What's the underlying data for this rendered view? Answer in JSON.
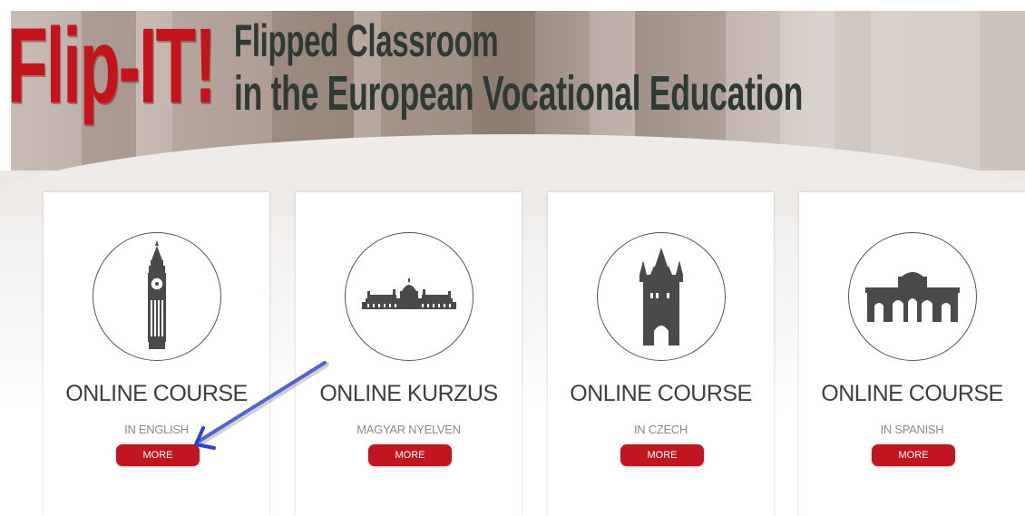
{
  "logo": {
    "brand": "Flip-IT!",
    "tagline_line1": "Flipped Classroom",
    "tagline_line2": "in the European Vocational Education",
    "brand_color": "#c3141d"
  },
  "cards": [
    {
      "icon": "big-ben-icon",
      "title": "ONLINE COURSE",
      "subtitle": "IN ENGLISH",
      "button": "MORE"
    },
    {
      "icon": "hungarian-parliament-icon",
      "title": "ONLINE KURZUS",
      "subtitle": "MAGYAR NYELVEN",
      "button": "MORE"
    },
    {
      "icon": "prague-tower-icon",
      "title": "ONLINE COURSE",
      "subtitle": "IN CZECH",
      "button": "MORE"
    },
    {
      "icon": "puerta-de-alcala-icon",
      "title": "ONLINE COURSE",
      "subtitle": "IN SPANISH",
      "button": "MORE"
    }
  ],
  "colors": {
    "button": "#c0161f",
    "annotation_arrow": "#2b3fd6"
  },
  "annotation": {
    "icon": "pointer-arrow-icon"
  }
}
